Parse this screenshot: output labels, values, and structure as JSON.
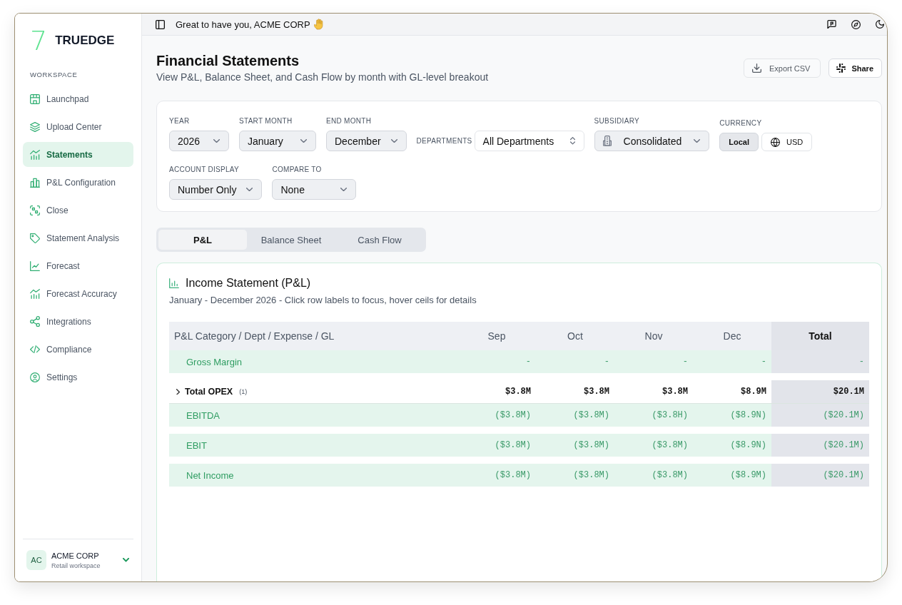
{
  "sidebar": {
    "logo_mark": "7",
    "brand": "TRUEDGE",
    "section": "WORKSPACE",
    "items": [
      {
        "label": "Launchpad",
        "selected": false
      },
      {
        "label": "Upload Center",
        "selected": false
      },
      {
        "label": "Statements",
        "selected": true
      },
      {
        "label": "P&L Configuration",
        "selected": false
      },
      {
        "label": "Close",
        "selected": false
      },
      {
        "label": "Statement Analysis",
        "selected": false
      },
      {
        "label": "Forecast",
        "selected": false
      },
      {
        "label": "Forecast Accuracy",
        "selected": false
      },
      {
        "label": "Integrations",
        "selected": false
      },
      {
        "label": "Compliance",
        "selected": false
      },
      {
        "label": "Settings",
        "selected": false
      }
    ],
    "account": {
      "initials": "AC",
      "name": "ACME CORP",
      "subtitle": "Retail workspace"
    }
  },
  "top_bar": {
    "greeting": "Great to have you, ACME CORP"
  },
  "header": {
    "title": "Financial Statements",
    "subtitle": "View P&L, Balance Sheet, and Cash Flow by month with GL-level breakout",
    "actions": [
      {
        "label": "Export CSV",
        "kind": "secondary"
      },
      {
        "label": "Share",
        "kind": "primary"
      }
    ]
  },
  "filters": {
    "rows": [
      [
        {
          "kind": "select",
          "label": "YEAR",
          "value": "2026"
        },
        {
          "kind": "select",
          "label": "START MONTH",
          "value": "January"
        },
        {
          "kind": "select",
          "label": "END MONTH",
          "value": "December"
        },
        {
          "kind": "inline-select",
          "label": "DEPARTMENTS",
          "value": "All Departments"
        },
        {
          "kind": "icon-select",
          "label": "SUBSIDIARY",
          "value": "Consolidated"
        },
        {
          "kind": "toggle",
          "label": "CURRENCY",
          "options": [
            {
              "label": "Local",
              "selected": true
            },
            {
              "label": "USD",
              "selected": false
            }
          ]
        }
      ],
      [
        {
          "kind": "select",
          "label": "ACCOUNT DISPLAY",
          "value": "Number Only"
        },
        {
          "kind": "select",
          "label": "COMPARE TO",
          "value": "None"
        }
      ]
    ]
  },
  "tabs": [
    {
      "label": "P&L",
      "selected": true
    },
    {
      "label": "Balance Sheet",
      "selected": false
    },
    {
      "label": "Cash Flow",
      "selected": false
    }
  ],
  "statement": {
    "title": "Income Statement (P&L)",
    "subtitle": "January - December 2026 - Click row labels to focus, hover ceils for details",
    "columns": [
      "P&L Category / Dept / Expense / GL",
      "Sep",
      "Oct",
      "Nov",
      "Dec",
      "Total"
    ],
    "rows": [
      {
        "kind": "subtotal",
        "label": "Gross Margin",
        "values": [
          "-",
          "-",
          "-",
          "-"
        ],
        "total": "-"
      },
      {
        "kind": "group",
        "label": "Total OPEX",
        "count": "(1)",
        "expanded": false,
        "values": [
          "$3.8M",
          "$3.8M",
          "$3.8M",
          "$8.9M"
        ],
        "total": "$20.1M"
      },
      {
        "kind": "subtotal",
        "label": "EBITDA",
        "values": [
          "($3.8M)",
          "($3.8M)",
          "($3.8H)",
          "($8.9N)"
        ],
        "total": "($20.1M)"
      },
      {
        "kind": "subtotal",
        "label": "EBIT",
        "values": [
          "($3.8M)",
          "($3.8M)",
          "($3.8M)",
          "($8.9N)"
        ],
        "total": "($20.1M)"
      },
      {
        "kind": "subtotal",
        "label": "Net Income",
        "values": [
          "($3.8M)",
          "($3.8M)",
          "($3.8M)",
          "($8.9M)"
        ],
        "total": "($20.1M)"
      }
    ]
  }
}
